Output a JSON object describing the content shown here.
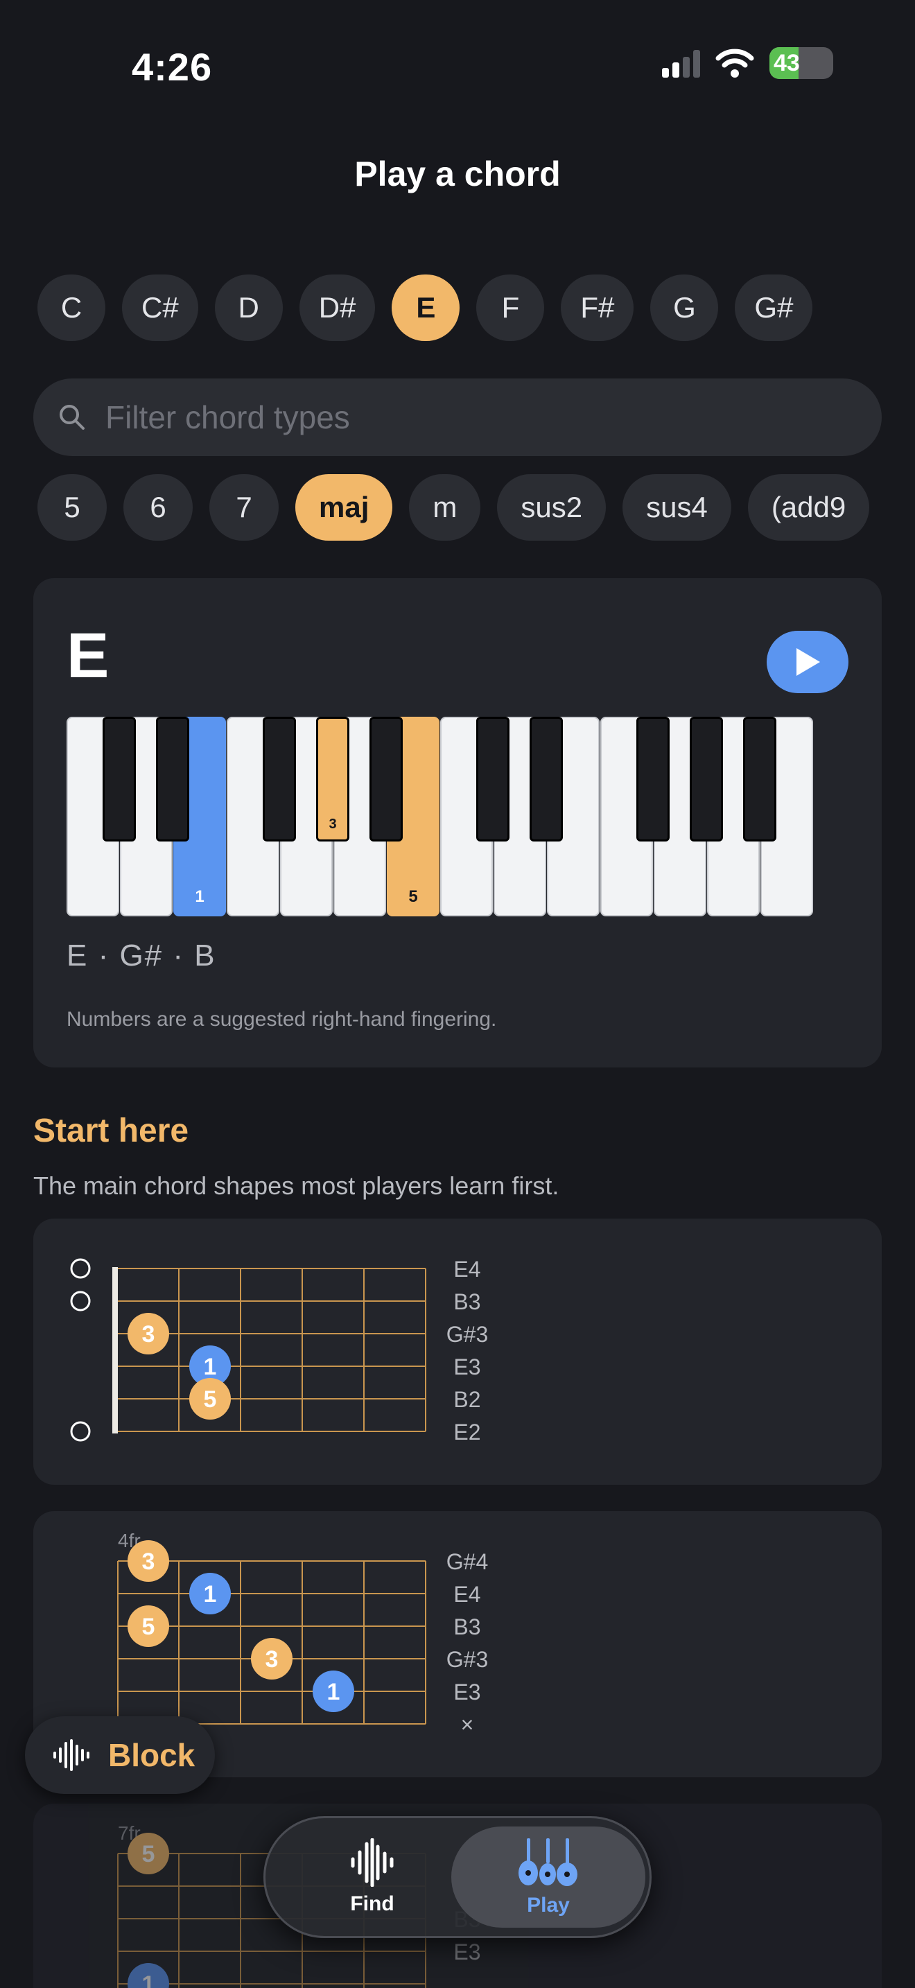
{
  "status_bar": {
    "time": "4:26",
    "battery": "43"
  },
  "header": {
    "title": "Play a chord"
  },
  "roots": [
    "C",
    "C#",
    "D",
    "D#",
    "E",
    "F",
    "F#",
    "G",
    "G#"
  ],
  "selected_root": "E",
  "search": {
    "placeholder": "Filter chord types"
  },
  "chord_types": [
    "5",
    "6",
    "7",
    "maj",
    "m",
    "sus2",
    "sus4",
    "(add9"
  ],
  "selected_type": "maj",
  "chord": {
    "name": "E",
    "notes": "E · G# · B",
    "fingering_note": "Numbers are a suggested right-hand fingering.",
    "fingers": {
      "root": "1",
      "third": "3",
      "fifth": "5"
    }
  },
  "start_here": {
    "title": "Start here",
    "subtitle": "The main chord shapes most players learn first."
  },
  "shapes": [
    {
      "fret_label": "",
      "strings": [
        "E4",
        "B3",
        "G#3",
        "E3",
        "B2",
        "E2"
      ]
    },
    {
      "fret_label": "4fr",
      "strings": [
        "G#4",
        "E4",
        "B3",
        "G#3",
        "E3",
        "×"
      ]
    },
    {
      "fret_label": "7fr",
      "strings": [
        "",
        "",
        "B3",
        "E3",
        "",
        ""
      ]
    }
  ],
  "block_button": {
    "label": "Block"
  },
  "tabbar": {
    "find": "Find",
    "play": "Play"
  },
  "colors": {
    "accent": "#f2b86a",
    "root": "#5b95f0",
    "background": "#17181d",
    "card": "#23252b"
  }
}
